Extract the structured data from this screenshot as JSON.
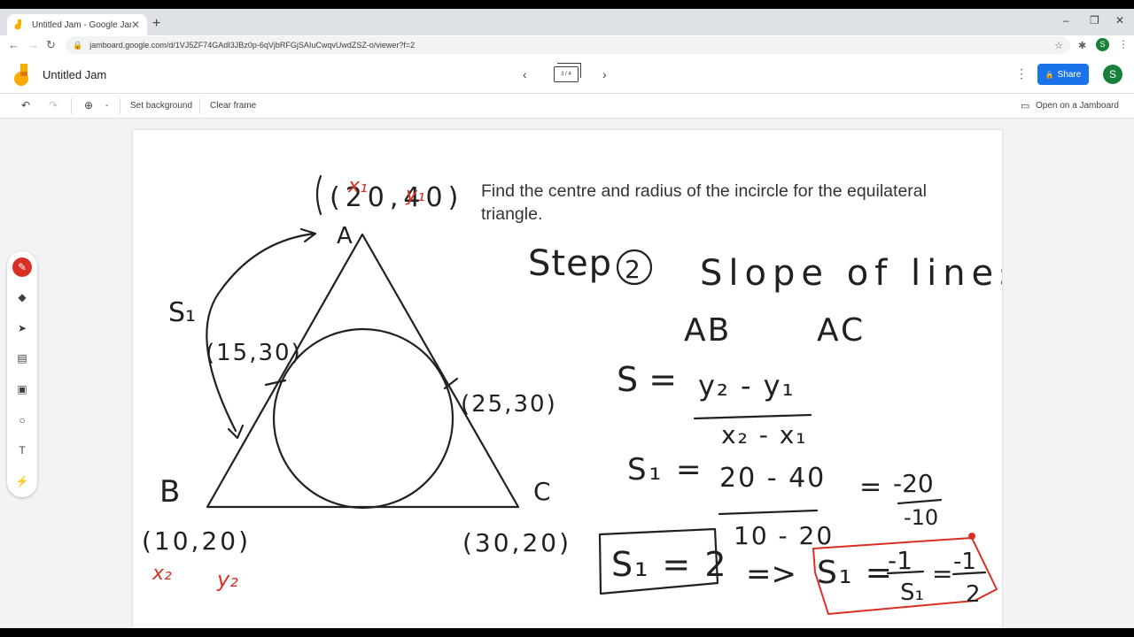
{
  "browser": {
    "tab_title": "Untitled Jam - Google Jamboard",
    "url": "jamboard.google.com/d/1VJ5ZF74GAdI3JBz0p-6qVjbRFGjSAIuCwqvUwdZSZ-o/viewer?f=2",
    "profile_initial": "S"
  },
  "app": {
    "title": "Untitled Jam",
    "frame_indicator": "3 / 4",
    "share_label": "Share",
    "avatar_initial": "S",
    "brand_color": "#f9ab00",
    "accent_color": "#1a73e8"
  },
  "toolbar": {
    "zoom_label": "-",
    "set_background": "Set background",
    "clear_frame": "Clear frame",
    "open_on_jamboard": "Open on a Jamboard"
  },
  "palette": {
    "tools": [
      "pen-icon",
      "eraser-icon",
      "select-icon",
      "sticky-note-icon",
      "image-icon",
      "circle-icon",
      "text-box-icon",
      "laser-icon"
    ],
    "active_tool": "pen-icon"
  },
  "canvas": {
    "prompt": "Find the centre and radius of the incircle for the equilateral triangle.",
    "handwriting": {
      "vertex_a_coords": "(20,40)",
      "vertex_a": "A",
      "x1": "x₁",
      "y1": "y₁",
      "vertex_b": "B",
      "vertex_b_coords": "(10,20)",
      "x2": "x₂",
      "y2": "y₂",
      "vertex_c": "C",
      "vertex_c_coords": "(30,20)",
      "s1": "S₁",
      "point_left": "(15,30)",
      "point_right": "(25,30)",
      "step": "Step",
      "step_number": "2",
      "slope_heading": "Slope of lines",
      "lines_ab": "AB",
      "lines_ac": "AC",
      "formula_lhs": "S =",
      "formula_num": "y₂ - y₁",
      "formula_den": "x₂ - x₁",
      "s1_eq": "S₁  =",
      "s1_num": "20 - 40",
      "s1_den": "10 - 20",
      "s1_eq2": "=",
      "simplified_num": "-20",
      "simplified_den": "-10",
      "boxed_result": "S₁ = 2",
      "implies": "=>",
      "perp_lhs": "S₁ =",
      "perp_frac_num": "-1",
      "perp_frac_den": "S₁",
      "perp_eq": "=",
      "perp_value_num": "-1",
      "perp_value_den": "2"
    }
  }
}
